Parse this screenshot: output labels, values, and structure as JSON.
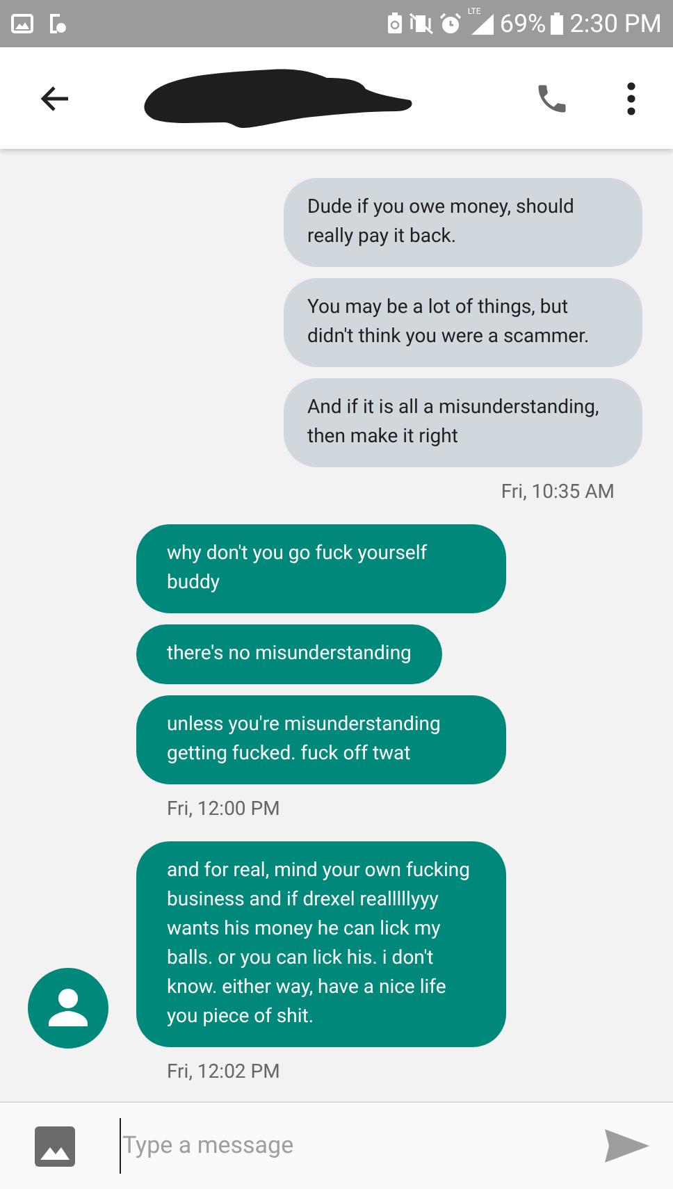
{
  "status_bar": {
    "network": "LTE",
    "battery": "69%",
    "time": "2:30 PM"
  },
  "header": {
    "title_redacted": true
  },
  "groups": [
    {
      "kind": "outgoing",
      "avatar": false,
      "messages": [
        "Dude if you owe money, should really pay it back.",
        "You may be a lot of things, but didn't think you were a scammer.",
        "And if it is all a misunderstanding, then make it right"
      ],
      "timestamp": "Fri, 10:35 AM"
    },
    {
      "kind": "incoming",
      "avatar": false,
      "messages": [
        "why don't you go fuck yourself buddy",
        "there's no misunderstanding",
        "unless you're misunderstanding getting fucked. fuck off twat"
      ],
      "timestamp": "Fri, 12:00 PM"
    },
    {
      "kind": "incoming",
      "avatar": true,
      "messages": [
        "and for real, mind your own fucking business and if drexel realllllyyy wants his money he can lick my balls. or you can lick his. i don't know. either way, have a nice life you piece of shit."
      ],
      "timestamp": "Fri, 12:02 PM"
    }
  ],
  "composer": {
    "placeholder": "Type a message"
  }
}
